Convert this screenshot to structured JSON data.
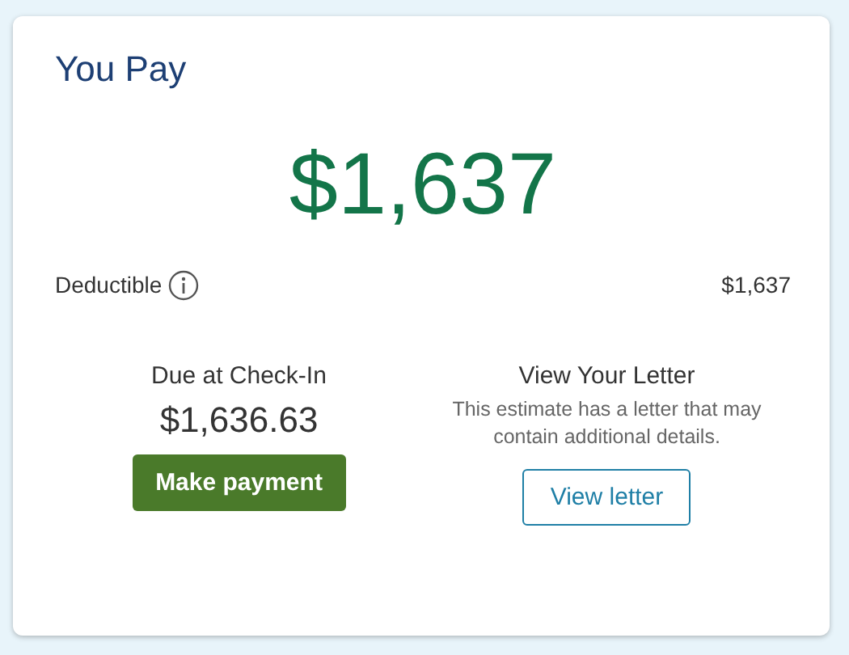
{
  "card": {
    "title": "You Pay",
    "total": "$1,637",
    "deductible": {
      "label": "Deductible",
      "amount": "$1,637"
    },
    "due": {
      "label": "Due at Check-In",
      "amount": "$1,636.63",
      "button": "Make payment"
    },
    "letter": {
      "title": "View Your Letter",
      "description": "This estimate has a letter that may contain additional details.",
      "button": "View letter"
    }
  }
}
